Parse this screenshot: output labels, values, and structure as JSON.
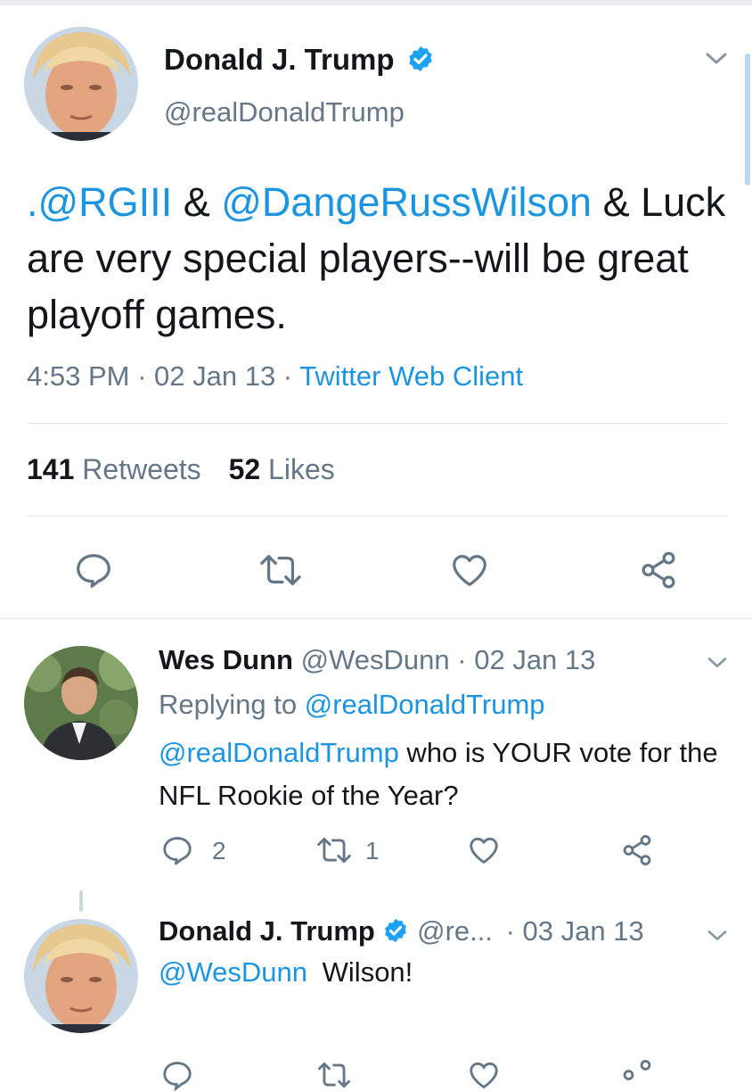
{
  "tweet": {
    "author_name": "Donald J. Trump",
    "author_handle": "@realDonaldTrump",
    "text_mention_1": ".@RGIII",
    "text_amp_1": " & ",
    "text_mention_2": "@DangeRussWilson",
    "text_rest": " & Luck are very special players--will be great playoff games.",
    "time": "4:53 PM",
    "date": "02 Jan 13",
    "source": "Twitter Web Client",
    "retweets_count": "141",
    "retweets_label": "Retweets",
    "likes_count": "52",
    "likes_label": "Likes"
  },
  "reply1": {
    "author_name": "Wes Dunn",
    "author_handle": "@WesDunn",
    "date": "02 Jan 13",
    "replying_prefix": "Replying to ",
    "replying_to": "@realDonaldTrump",
    "text_mention": "@realDonaldTrump",
    "text_rest": " who is YOUR vote for the NFL Rookie of the Year?",
    "reply_count": "2",
    "retweet_count": "1"
  },
  "reply2": {
    "author_name": "Donald J. Trump",
    "author_handle": "@re...",
    "date": "03 Jan 13",
    "text_mention": "@WesDunn",
    "text_rest": "Wilson!"
  },
  "dot": " · ",
  "icons": [
    "verified-badge-icon",
    "chevron-down-icon",
    "reply-icon",
    "retweet-icon",
    "like-icon",
    "share-icon"
  ],
  "colors": {
    "link": "#1b95e0",
    "secondary": "#657786",
    "verified": "#1da1f2",
    "text": "#14171a"
  }
}
